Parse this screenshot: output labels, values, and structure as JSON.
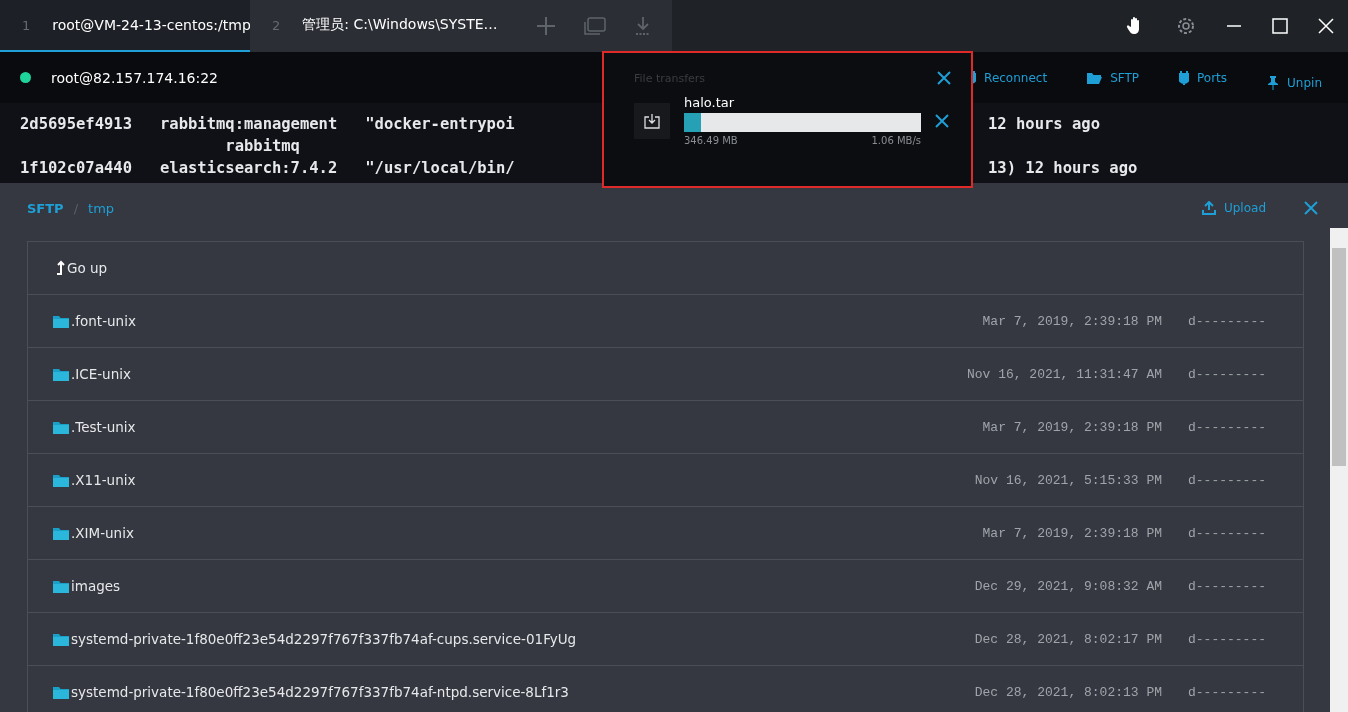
{
  "tabs": [
    {
      "number": "1",
      "label": "root@VM-24-13-centos:/tmp",
      "selected": true
    },
    {
      "number": "2",
      "label": "管理员: C:\\Windows\\SYSTE…",
      "selected": false
    }
  ],
  "connection": {
    "connected": true,
    "host": "root@82.157.174.16:22",
    "actions": [
      "Reconnect",
      "SFTP",
      "Ports"
    ],
    "unpin": "Unpin"
  },
  "terminal": {
    "lines": [
      {
        "left": "2d5695ef4913   rabbitmq:management   \"docker-entrypoi",
        "right": "12 hours ago"
      },
      {
        "left": "                      rabbitmq"
      },
      {
        "left": "1f102c07a440   elasticsearch:7.4.2   \"/usr/local/bin/",
        "right": "13) 12 hours ago"
      }
    ]
  },
  "file_transfers": {
    "title": "File transfers",
    "items": [
      {
        "name": "halo.tar",
        "level": 0.07,
        "size": "346.49 MB",
        "speed": "1.06 MB/s"
      }
    ]
  },
  "sftp": {
    "breadcrumb": [
      "SFTP",
      "tmp"
    ],
    "breadcrumb_separator": "/",
    "upload": "Upload",
    "go_up": "Go up",
    "rows": [
      {
        "name": ".font-unix",
        "modified": "Mar 7, 2019, 2:39:18 PM",
        "mode": "d---------"
      },
      {
        "name": ".ICE-unix",
        "modified": "Nov 16, 2021, 11:31:47 AM",
        "mode": "d---------"
      },
      {
        "name": ".Test-unix",
        "modified": "Mar 7, 2019, 2:39:18 PM",
        "mode": "d---------"
      },
      {
        "name": ".X11-unix",
        "modified": "Nov 16, 2021, 5:15:33 PM",
        "mode": "d---------"
      },
      {
        "name": ".XIM-unix",
        "modified": "Mar 7, 2019, 2:39:18 PM",
        "mode": "d---------"
      },
      {
        "name": "images",
        "modified": "Dec 29, 2021, 9:08:32 AM",
        "mode": "d---------"
      },
      {
        "name": "systemd-private-1f80e0ff23e54d2297f767f337fb74af-cups.service-01FyUg",
        "modified": "Dec 28, 2021, 8:02:17 PM",
        "mode": "d---------"
      },
      {
        "name": "systemd-private-1f80e0ff23e54d2297f767f337fb74af-ntpd.service-8Lf1r3",
        "modified": "Dec 28, 2021, 8:02:13 PM",
        "mode": "d---------"
      }
    ]
  }
}
